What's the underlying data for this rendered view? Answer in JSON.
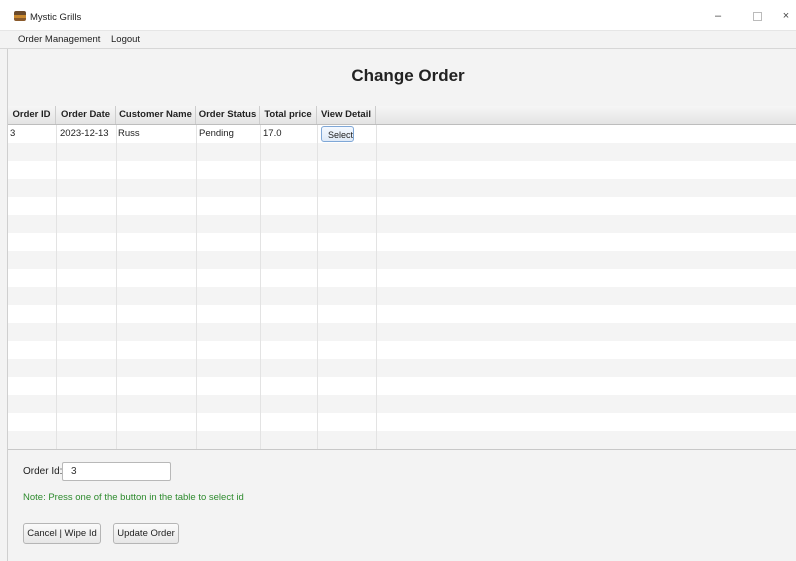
{
  "window": {
    "title": "Mystic Grills",
    "minimize": "–",
    "close": "×"
  },
  "menu": {
    "items": [
      "Order Management",
      "Logout"
    ]
  },
  "page": {
    "title": "Change Order"
  },
  "table": {
    "columns": [
      "Order ID",
      "Order Date",
      "Customer Name",
      "Order Status",
      "Total price",
      "View Detail"
    ],
    "rows": [
      {
        "order_id": "3",
        "order_date": "2023-12-13",
        "customer_name": "Russ",
        "order_status": "Pending",
        "total_price": "17.0",
        "action": "Select"
      }
    ]
  },
  "form": {
    "order_id_label": "Order Id:",
    "order_id_value": "3",
    "note": "Note: Press one of the button in the table to select id",
    "cancel_label": "Cancel | Wipe Id",
    "update_label": "Update Order"
  },
  "colors": {
    "note": "#2e8b2e",
    "select_border": "#7fa7d6"
  }
}
